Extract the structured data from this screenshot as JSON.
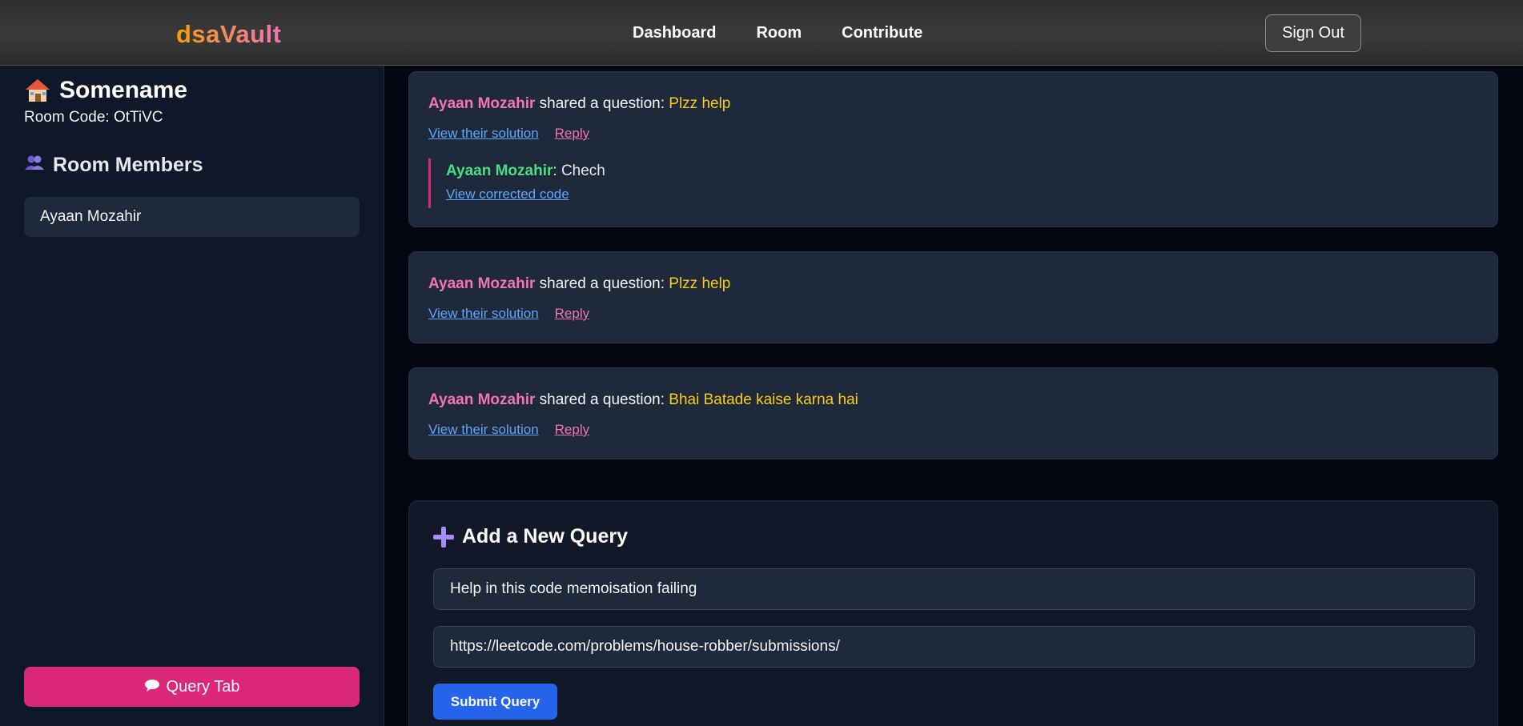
{
  "app": {
    "brand": "dsaVault"
  },
  "nav": {
    "items": [
      "Dashboard",
      "Room",
      "Contribute"
    ],
    "sign_out": "Sign Out"
  },
  "sidebar": {
    "room_name": "Somename",
    "room_code": "Room Code: OtTiVC",
    "members_title": "Room Members",
    "members": [
      "Ayaan Mozahir"
    ],
    "query_tab": "Query Tab"
  },
  "feed": {
    "shared_text": " shared a question: ",
    "view_solution": "View their solution",
    "reply": "Reply",
    "posts": [
      {
        "author": "Ayaan Mozahir",
        "question": "Plzz help",
        "reply": {
          "author": "Ayaan Mozahir",
          "text": ": Chech",
          "link": "View corrected code"
        }
      },
      {
        "author": "Ayaan Mozahir",
        "question": "Plzz help"
      },
      {
        "author": "Ayaan Mozahir",
        "question": "Bhai Batade kaise karna hai"
      }
    ]
  },
  "form": {
    "title": "Add a New Query",
    "question_value": "Help in this code memoisation failing",
    "link_value": "https://leetcode.com/problems/house-robber/submissions/",
    "submit": "Submit Query"
  },
  "colors": {
    "accent_pink": "#db2777",
    "author_pink": "#f472b6",
    "question_yellow": "#facc15",
    "reply_green": "#4ade80",
    "link_blue": "#60a5fa",
    "submit_blue": "#2563eb"
  },
  "icons": {
    "room": "house-icon",
    "members": "members-icon",
    "query_tab": "speech-bubble-icon",
    "form": "plus-icon"
  }
}
